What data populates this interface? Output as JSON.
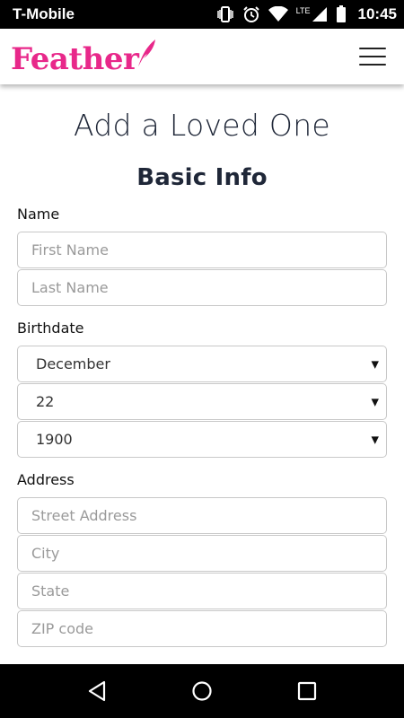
{
  "status_bar": {
    "carrier": "T-Mobile",
    "network": "LTE",
    "time": "10:45"
  },
  "header": {
    "logo_text": "Feather"
  },
  "page": {
    "title": "Add a Loved One",
    "section_title": "Basic Info"
  },
  "name_group": {
    "label": "Name",
    "first_name_placeholder": "First Name",
    "last_name_placeholder": "Last Name"
  },
  "birthdate_group": {
    "label": "Birthdate",
    "month": "December",
    "day": "22",
    "year": "1900"
  },
  "address_group": {
    "label": "Address",
    "street_placeholder": "Street Address",
    "city_placeholder": "City",
    "state_placeholder": "State",
    "zip_placeholder": "ZIP code"
  },
  "colors": {
    "brand_pink": "#e8288a",
    "text_dark": "#1f2738",
    "field_border": "#c8c8c8"
  }
}
